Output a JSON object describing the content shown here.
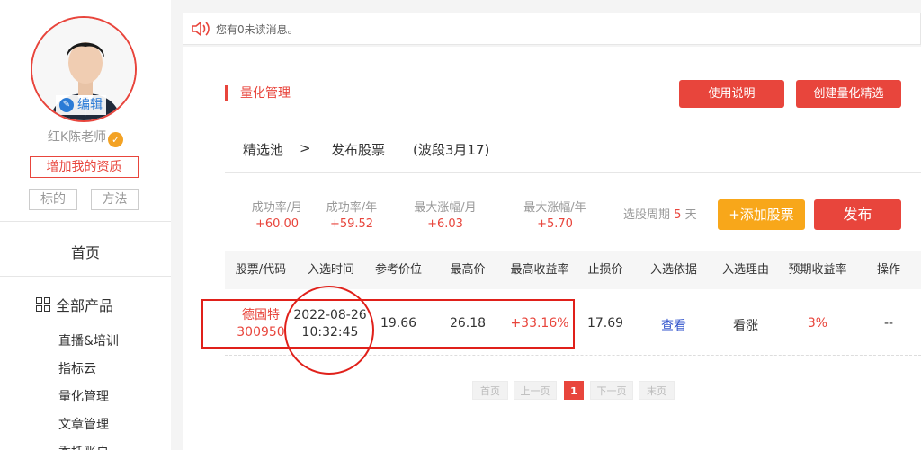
{
  "sidebar": {
    "edit_label": "编辑",
    "teacher_name": "红K陈老师",
    "qualification_btn": "增加我的资质",
    "tags": [
      "标的",
      "方法"
    ],
    "home": "首页",
    "all_products": "全部产品",
    "menu": [
      "直播&培训",
      "指标云",
      "量化管理",
      "文章管理",
      "委托账户"
    ]
  },
  "notice": {
    "text": "您有0未读消息。"
  },
  "section": {
    "title": "量化管理",
    "usage_btn": "使用说明",
    "create_btn": "创建量化精选"
  },
  "breadcrumb": {
    "pool": "精选池",
    "sep": ">",
    "publish": "发布股票",
    "band": "(波段3月17)"
  },
  "stats": [
    {
      "label": "成功率/月",
      "value": "+60.00"
    },
    {
      "label": "成功率/年",
      "value": "+59.52"
    },
    {
      "label": "最大涨幅/月",
      "value": "+6.03"
    },
    {
      "label": "最大涨幅/年",
      "value": "+5.70"
    }
  ],
  "cycle": {
    "prefix": "选股周期",
    "num": "5",
    "suffix": "天"
  },
  "actions": {
    "add_stock": "+添加股票",
    "publish": "发布"
  },
  "table": {
    "headers": [
      "股票/代码",
      "入选时间",
      "参考价位",
      "最高价",
      "最高收益率",
      "止损价",
      "入选依据",
      "入选理由",
      "预期收益率",
      "操作"
    ],
    "row": {
      "name": "德固特",
      "code": "300950",
      "date": "2022-08-26",
      "time": "10:32:45",
      "ref_price": "19.66",
      "high": "26.18",
      "max_return": "+33.16%",
      "stop_loss": "17.69",
      "basis": "查看",
      "reason": "看涨",
      "expected": "3%",
      "op": "--"
    }
  },
  "pager": {
    "first": "首页",
    "prev": "上一页",
    "current": "1",
    "next": "下一页",
    "last": "末页"
  },
  "colors": {
    "accent": "#e8453c",
    "orange": "#f8a71a",
    "link": "#3355cc"
  }
}
